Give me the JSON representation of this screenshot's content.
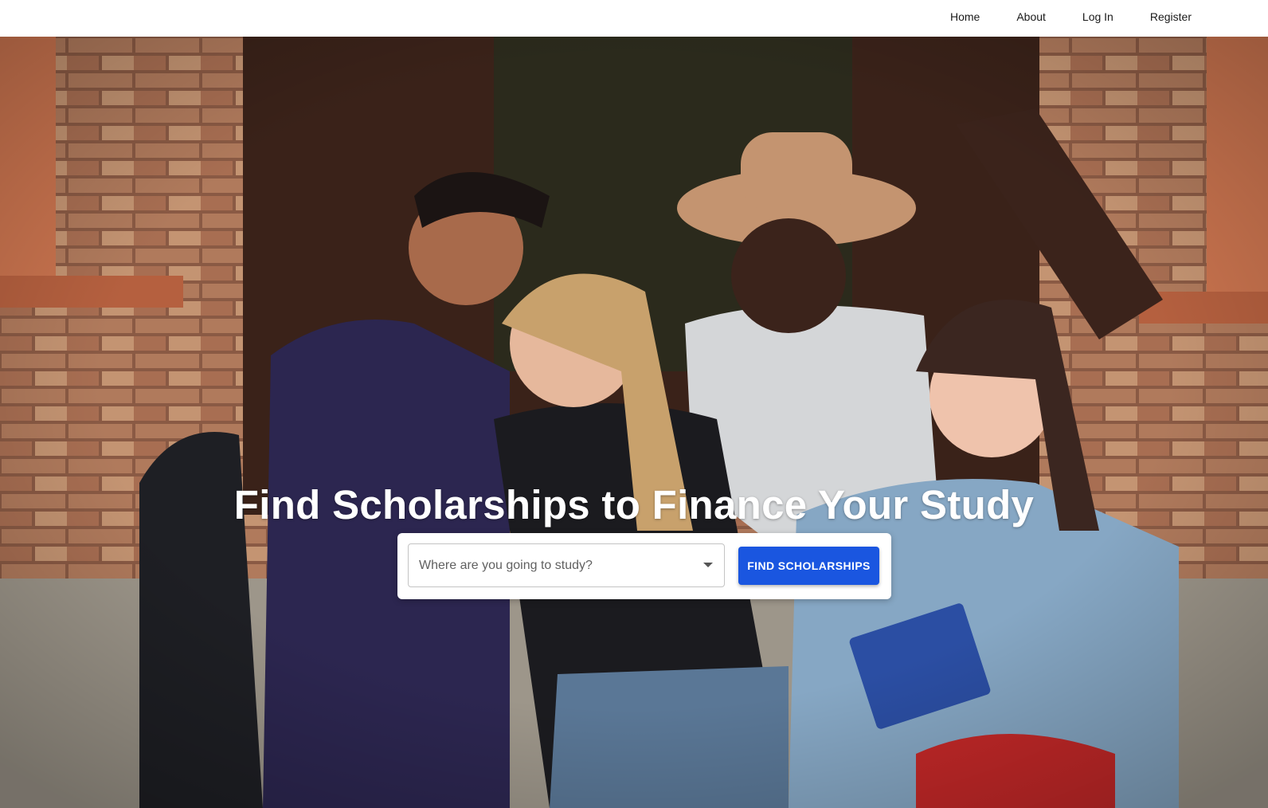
{
  "nav": {
    "items": [
      {
        "label": "Home"
      },
      {
        "label": "About"
      },
      {
        "label": "Log In"
      },
      {
        "label": "Register"
      }
    ]
  },
  "hero": {
    "title": "Find Scholarships to Finance Your Study",
    "image_description": "",
    "search": {
      "placeholder": "Where are you going to study?",
      "button_label": "FIND SCHOLARSHIPS"
    }
  },
  "colors": {
    "accent": "#1a56e0",
    "nav_background": "#ffffff",
    "title_text": "#ffffff"
  }
}
